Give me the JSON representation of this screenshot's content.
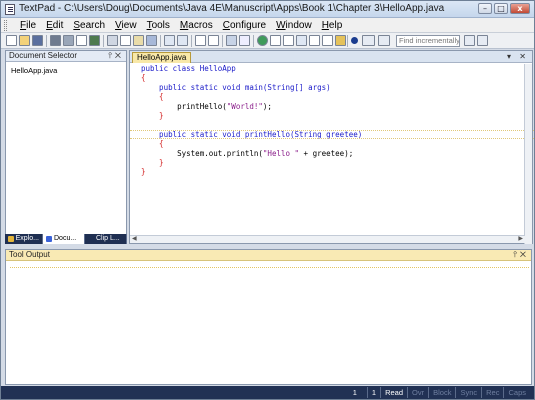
{
  "window": {
    "title": "TextPad - C:\\Users\\Doug\\Documents\\Java 4E\\Manuscript\\Apps\\Book 1\\Chapter 3\\HelloApp.java",
    "buttons": {
      "minimize": "–",
      "maximize": "□",
      "close": "x"
    }
  },
  "menu": [
    {
      "label": "File",
      "underline": "F",
      "rest": "ile"
    },
    {
      "label": "Edit",
      "underline": "E",
      "rest": "dit"
    },
    {
      "label": "Search",
      "underline": "S",
      "rest": "earch"
    },
    {
      "label": "View",
      "underline": "V",
      "rest": "iew"
    },
    {
      "label": "Tools",
      "underline": "T",
      "rest": "ools"
    },
    {
      "label": "Macros",
      "underline": "M",
      "rest": "acros"
    },
    {
      "label": "Configure",
      "underline": "C",
      "rest": "onfigure"
    },
    {
      "label": "Window",
      "underline": "W",
      "rest": "indow"
    },
    {
      "label": "Help",
      "underline": "H",
      "rest": "elp"
    }
  ],
  "toolbar": {
    "find_placeholder": "Find incrementally"
  },
  "document_selector": {
    "title": "Document Selector",
    "pin": "⫯",
    "close": "✕",
    "items": [
      "HelloApp.java"
    ]
  },
  "left_tabs": [
    {
      "label": "Explo...",
      "icon_color": "#e3b53a"
    },
    {
      "label": "Docu...",
      "icon_color": "#3a62d8"
    },
    {
      "label": "Clip L...",
      "icon_color": "#1f2f52"
    }
  ],
  "editor": {
    "tab_label": "HelloApp.java",
    "tab_controls": "▾ ✕",
    "code_lines": [
      [
        {
          "t": "public class HelloApp",
          "c": "kw"
        }
      ],
      [
        {
          "t": "{",
          "c": "br"
        }
      ],
      [
        {
          "t": "    public static void main(String[] args)",
          "c": "kw"
        }
      ],
      [
        {
          "t": "    {",
          "c": "br"
        }
      ],
      [
        {
          "t": "        printHello(",
          "c": "plain"
        },
        {
          "t": "\"World!\"",
          "c": "str"
        },
        {
          "t": ");",
          "c": "plain"
        }
      ],
      [
        {
          "t": "    }",
          "c": "br"
        }
      ],
      [
        {
          "t": "",
          "c": "plain"
        }
      ],
      [
        {
          "t": "    public static void printHello(String greetee)",
          "c": "kw"
        }
      ],
      [
        {
          "t": "    {",
          "c": "br"
        }
      ],
      [
        {
          "t": "        System.out.println(",
          "c": "plain"
        },
        {
          "t": "\"Hello \"",
          "c": "str"
        },
        {
          "t": " + greetee);",
          "c": "plain"
        }
      ],
      [
        {
          "t": "    }",
          "c": "br"
        }
      ],
      [
        {
          "t": "}",
          "c": "br"
        }
      ]
    ],
    "current_line_index": 7
  },
  "tool_output": {
    "title": "Tool Output",
    "pin": "⫯",
    "close": "✕"
  },
  "status": {
    "line": "1",
    "col": "1",
    "read": "Read",
    "ovr": "Ovr",
    "block": "Block",
    "sync": "Sync",
    "rec": "Rec",
    "caps": "Caps"
  }
}
